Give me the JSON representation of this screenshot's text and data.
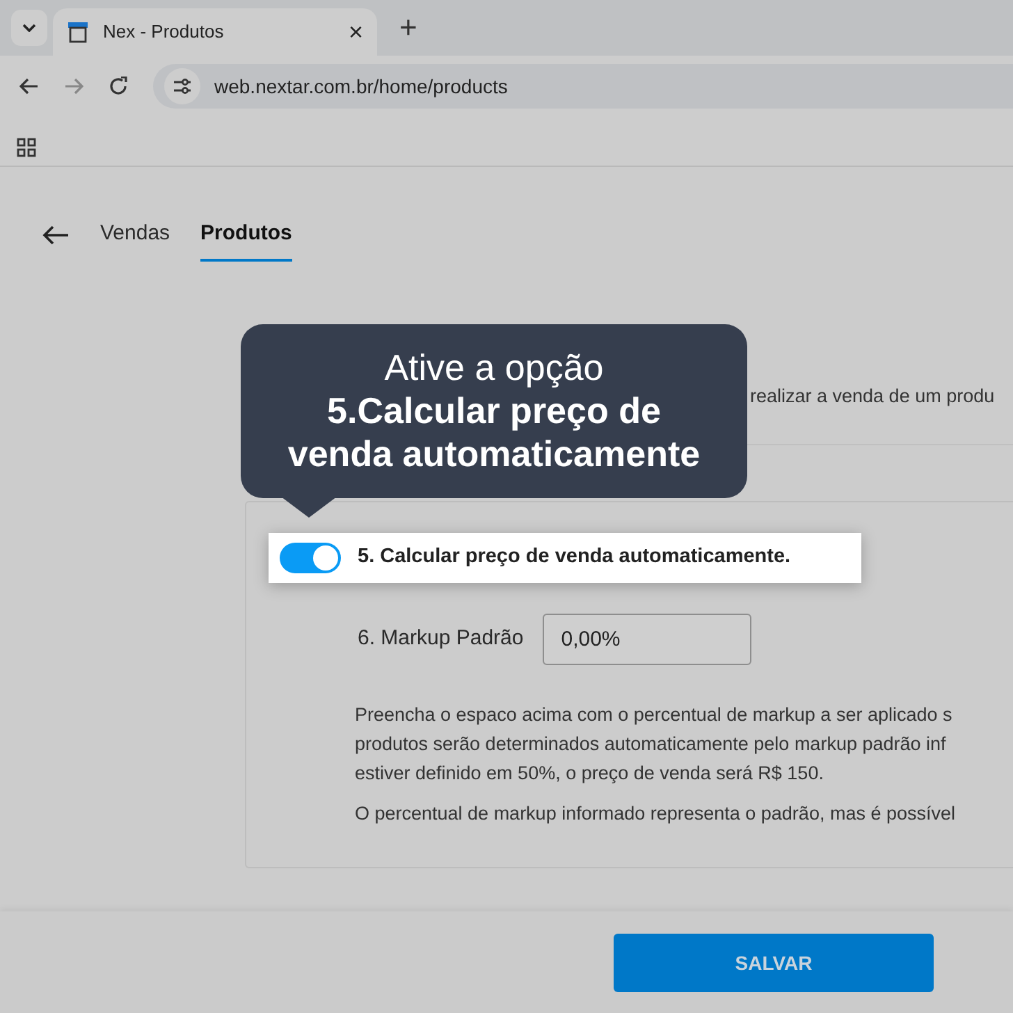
{
  "browser": {
    "tab_title": "Nex - Produtos",
    "tab_close": "×",
    "new_tab": "+",
    "url": "web.nextar.com.br/home/products"
  },
  "nav": {
    "tabs": [
      {
        "label": "Vendas",
        "selected": false
      },
      {
        "label": "Produtos",
        "selected": true
      }
    ]
  },
  "section_text": "realizar a venda de um produ",
  "toggle": {
    "label": "5. Calcular preço de venda automaticamente.",
    "on": true
  },
  "markup": {
    "label": "6. Markup Padrão",
    "value": "0,00%"
  },
  "help_lines": [
    "Preencha o espaco acima com o percentual de markup a ser aplicado s",
    "produtos serão determinados automaticamente pelo markup padrão inf",
    "estiver definido em 50%, o preço de venda será R$ 150."
  ],
  "help_note": "O percentual de markup informado representa o padrão, mas é possível",
  "tooltip": {
    "line_1": "Ative a opção",
    "line_2": "5.Calcular preço de",
    "line_3": "venda automaticamente"
  },
  "save_button": "SALVAR"
}
